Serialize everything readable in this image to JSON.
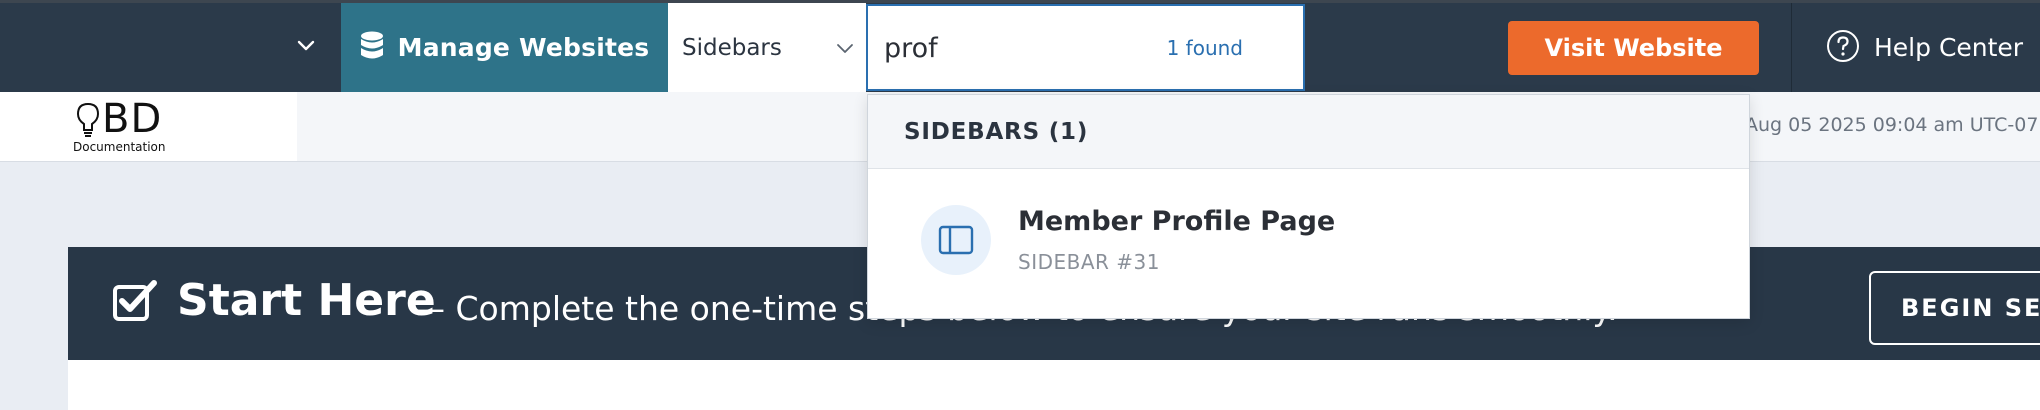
{
  "topbar": {
    "manage_label": "Manage Websites",
    "type_select_value": "Sidebars",
    "search_value": "prof",
    "found_count": "1 found",
    "visit_label": "Visit Website",
    "help_label": "Help Center",
    "icons": {
      "left_dropdown": "chevron-down-icon",
      "manage": "database-icon",
      "type_select": "chevron-down-icon",
      "help": "question-circle-icon"
    }
  },
  "subheader": {
    "logo_text": "BD",
    "logo_subtext": "Documentation",
    "datetime": "Aug 05 2025 09:04 am UTC-07"
  },
  "banner": {
    "title": "Start Here",
    "subtitle": "— Complete the one-time steps below to ensure your site runs smoothly.",
    "begin_label": "BEGIN SETUP",
    "icon": "check-square-icon"
  },
  "search_results": {
    "group_title": "SIDEBARS (1)",
    "items": [
      {
        "title": "Member Profile Page",
        "subtitle": "SIDEBAR #31",
        "icon": "sidebar-layout-icon"
      }
    ]
  },
  "colors": {
    "topbar_bg": "#2b3a4a",
    "manage_bg": "#2e7389",
    "visit_bg": "#ec6a2c",
    "accent_blue": "#2a6fb0",
    "banner_bg": "#283747",
    "page_bg": "#e9edf3"
  }
}
